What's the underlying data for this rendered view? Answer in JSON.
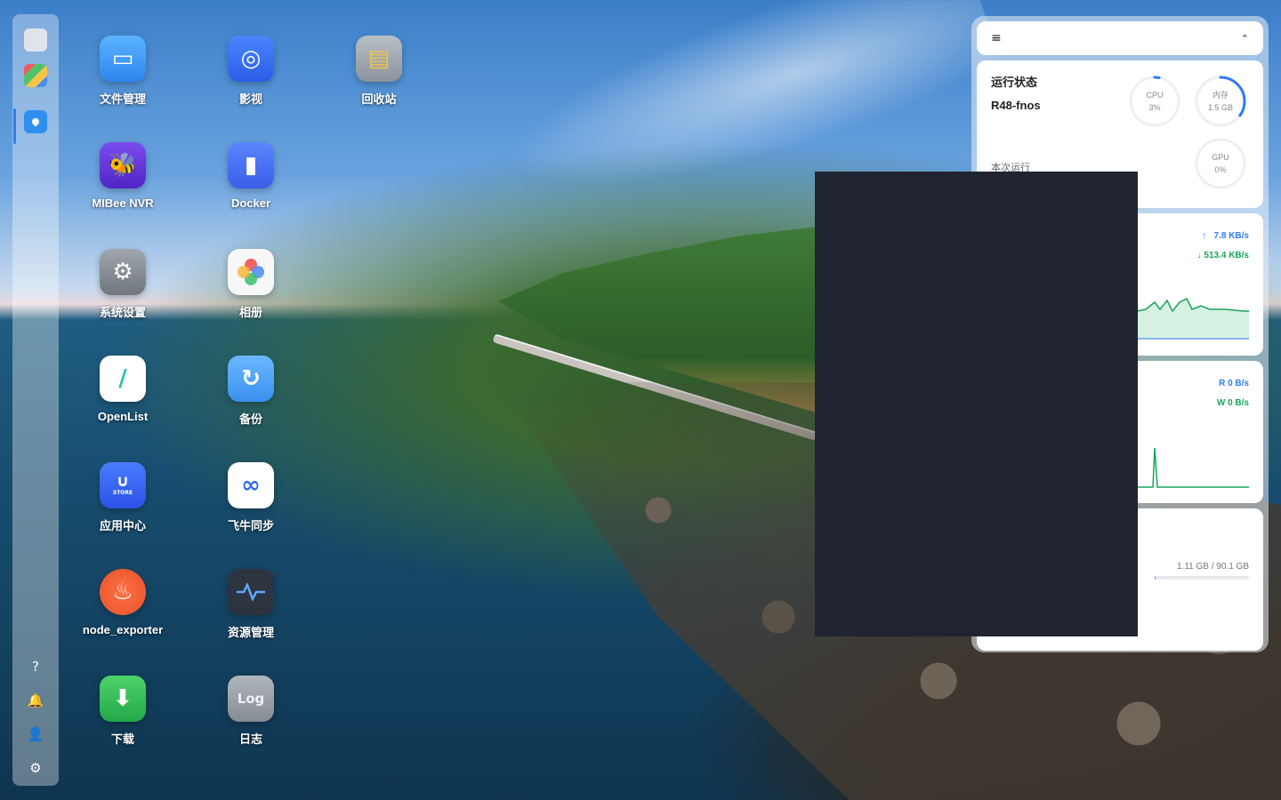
{
  "dock": {
    "items": [
      {
        "name": "files",
        "icon": "folder-icon"
      },
      {
        "name": "apps",
        "icon": "grid-icon"
      },
      {
        "name": "map",
        "icon": "location-pin-icon",
        "active": true
      }
    ],
    "bottom_icons": [
      "help-icon",
      "bell-icon",
      "user-icon",
      "gear-icon"
    ]
  },
  "desktop": {
    "apps": [
      {
        "label": "文件管理",
        "icon": "folder-icon",
        "color": "#3a9af5"
      },
      {
        "label": "影视",
        "icon": "film-camera-icon",
        "color": "#2f6cf2"
      },
      {
        "label": "回收站",
        "icon": "trash-icon",
        "color": "#9aa3ad"
      },
      {
        "label": "MIBee NVR",
        "icon": "bee-icon",
        "color": "#6a3bd8"
      },
      {
        "label": "Docker",
        "icon": "docker-whale-icon",
        "color": "#3e6df0"
      },
      {
        "label": "系统设置",
        "icon": "settings-icon",
        "color": "#8e949c"
      },
      {
        "label": "相册",
        "icon": "photo-petals-icon",
        "color": "#f5f5f5"
      },
      {
        "label": "OpenList",
        "icon": "openlist-icon",
        "color": "#ffffff"
      },
      {
        "label": "备份",
        "icon": "backup-icon",
        "color": "#4aa3f4"
      },
      {
        "label": "应用中心",
        "icon": "store-bag-icon",
        "color": "#2f6cf2"
      },
      {
        "label": "飞牛同步",
        "icon": "sync-icon",
        "color": "#ffffff"
      },
      {
        "label": "node_exporter",
        "icon": "prometheus-icon",
        "color": "#e6522c"
      },
      {
        "label": "资源管理",
        "icon": "pulse-monitor-icon",
        "color": "#2d3440"
      },
      {
        "label": "下载",
        "icon": "download-icon",
        "color": "#2fb84f"
      },
      {
        "label": "日志",
        "icon": "log-icon",
        "color": "#8e949c"
      }
    ],
    "store_badge": "STORE",
    "log_badge": "Log"
  },
  "widget": {
    "header_icon": "list-menu-icon",
    "collapse_icon": "chevron-double-up-icon",
    "status": {
      "title": "运行状态",
      "host": "R48-fnos",
      "runtime_label": "本次运行",
      "cpu": {
        "label": "CPU",
        "value": "3%",
        "percent": 3
      },
      "memory": {
        "label": "内存",
        "value": "1.5 GB",
        "percent": 35
      },
      "gpu": {
        "label": "GPU",
        "value": "0%",
        "percent": 0
      }
    },
    "network": {
      "upload": "7.8 KB/s",
      "download": "513.4 KB/s",
      "upload_icon": "upload-arrow-icon",
      "download_icon": "download-arrow-icon"
    },
    "disk": {
      "read": "R 0 B/s",
      "write": "W 0 B/s"
    },
    "storage": {
      "usage": "1.11 GB / 90.1 GB",
      "fill": 0.012
    }
  },
  "colors": {
    "accent": "#2f7bf5",
    "green": "#19a35a"
  }
}
